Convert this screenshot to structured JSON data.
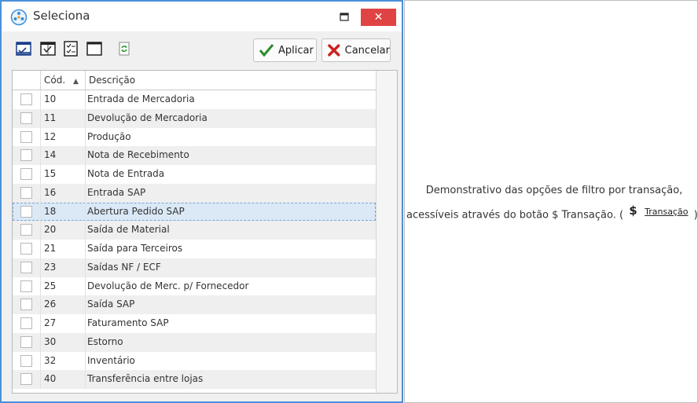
{
  "window": {
    "title": "Seleciona",
    "close_label": "✕"
  },
  "toolbar": {
    "apply_label": "Aplicar",
    "cancel_label": "Cancelar"
  },
  "grid": {
    "columns": [
      "Cód.",
      "Descrição"
    ],
    "sort_indicator": "▲",
    "rows": [
      {
        "code": "10",
        "desc": "Entrada de Mercadoria"
      },
      {
        "code": "11",
        "desc": "Devolução de Mercadoria"
      },
      {
        "code": "12",
        "desc": "Produção"
      },
      {
        "code": "14",
        "desc": "Nota de Recebimento"
      },
      {
        "code": "15",
        "desc": "Nota de Entrada"
      },
      {
        "code": "16",
        "desc": "Entrada SAP"
      },
      {
        "code": "18",
        "desc": "Abertura Pedido SAP"
      },
      {
        "code": "20",
        "desc": "Saída de Material"
      },
      {
        "code": "21",
        "desc": "Saída para Terceiros"
      },
      {
        "code": "23",
        "desc": "Saídas NF / ECF"
      },
      {
        "code": "25",
        "desc": "Devolução de Merc. p/ Fornecedor"
      },
      {
        "code": "26",
        "desc": "Saída SAP"
      },
      {
        "code": "27",
        "desc": "Faturamento SAP"
      },
      {
        "code": "30",
        "desc": "Estorno"
      },
      {
        "code": "32",
        "desc": "Inventário"
      },
      {
        "code": "40",
        "desc": "Transferência entre lojas"
      }
    ]
  },
  "caption": {
    "line1": "Demonstrativo das opções de filtro por transação,",
    "line2_prefix": "acessíveis através do botão $ Transação. (",
    "line2_suffix": ")",
    "button_symbol": "$",
    "button_label": "Transação"
  },
  "colors": {
    "window_border": "#4a90d9",
    "close_button": "#e04343",
    "selected_row": "#dbe9f7",
    "apply_check": "#2e8b2e",
    "cancel_x": "#cc2222"
  }
}
